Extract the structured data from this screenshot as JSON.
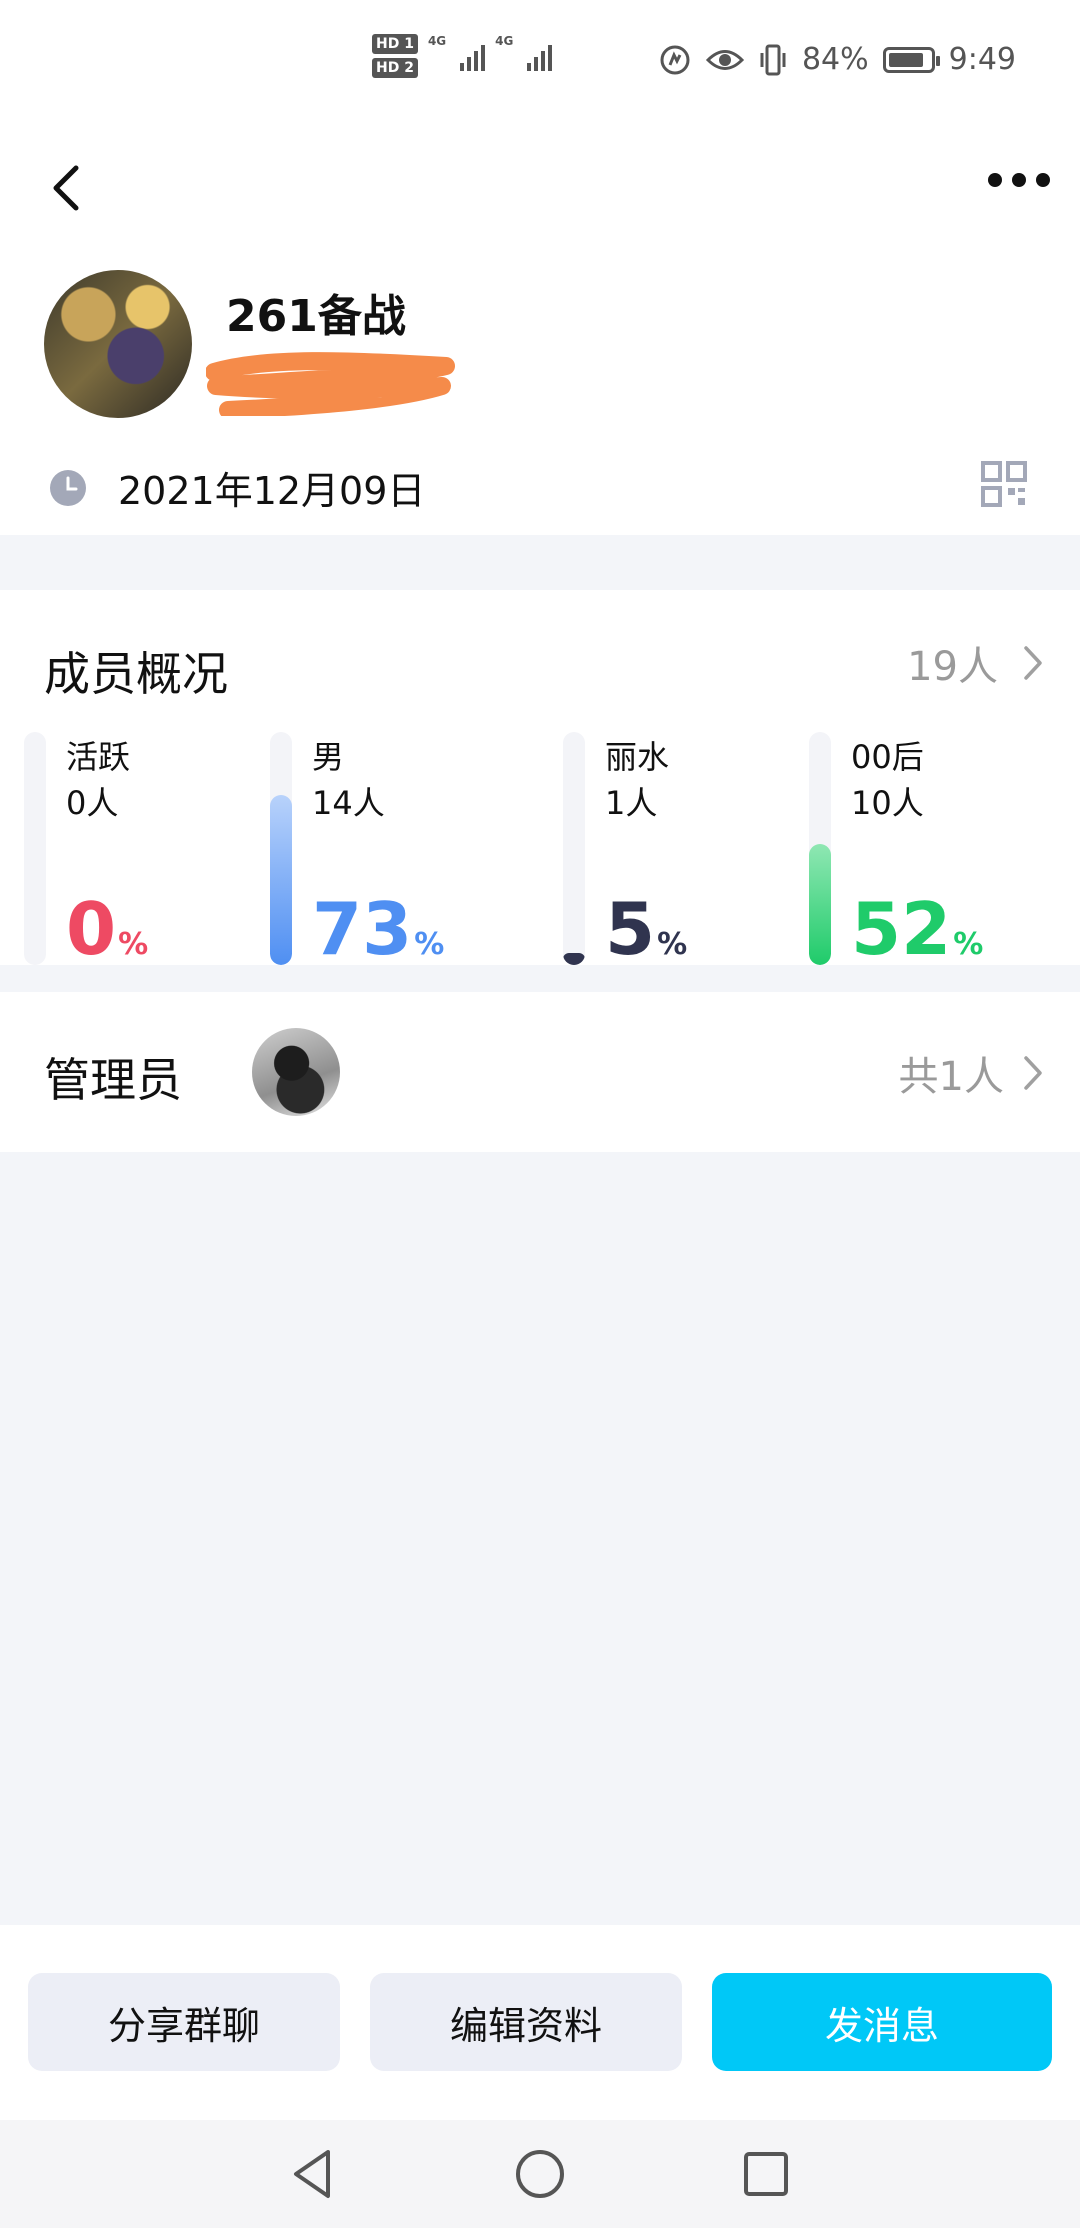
{
  "status_bar": {
    "hd1": "HD 1",
    "hd2": "HD 2",
    "network1": "4G",
    "network2": "4G",
    "battery_percent": "84%",
    "battery_level": 0.84,
    "time": "9:49"
  },
  "header": {
    "icons": [
      "back-icon",
      "more-icon"
    ]
  },
  "group": {
    "name": "261备战",
    "created_date": "2021年12月09日"
  },
  "members": {
    "title": "成员概况",
    "total": "19人",
    "stats": [
      {
        "label": "活跃",
        "count": "0人",
        "percent_value": "0",
        "percent_symbol": "%",
        "fraction": 0.0,
        "color": "#ee4a63"
      },
      {
        "label": "男",
        "count": "14人",
        "percent_value": "73",
        "percent_symbol": "%",
        "fraction": 0.73,
        "color": "#4f8ff2"
      },
      {
        "label": "丽水",
        "count": "1人",
        "percent_value": "5",
        "percent_symbol": "%",
        "fraction": 0.05,
        "color": "#30344f"
      },
      {
        "label": "00后",
        "count": "10人",
        "percent_value": "52",
        "percent_symbol": "%",
        "fraction": 0.52,
        "color": "#1fcb6a"
      }
    ]
  },
  "admins": {
    "title": "管理员",
    "count": "共1人"
  },
  "actions": {
    "share": "分享群聊",
    "edit": "编辑资料",
    "message": "发消息"
  },
  "colors": {
    "primary": "#00c8f7",
    "page_bg": "#f3f5f9"
  }
}
